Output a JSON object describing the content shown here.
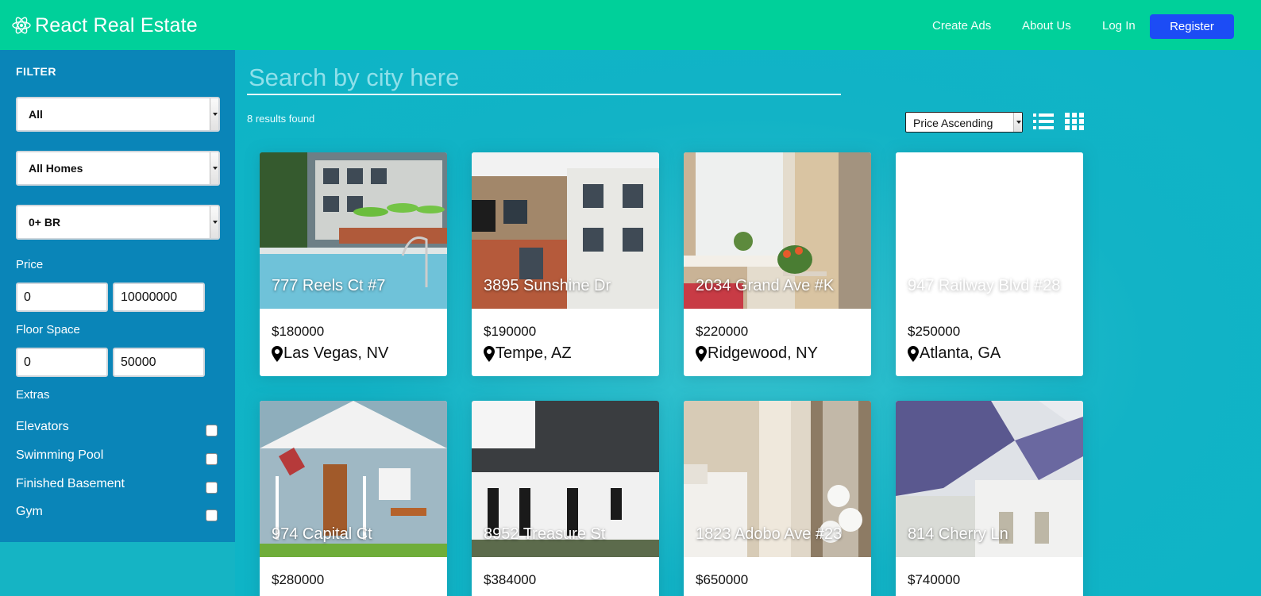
{
  "header": {
    "brand": "React Real Estate",
    "nav": {
      "create_ads": "Create Ads",
      "about_us": "About Us",
      "log_in": "Log In",
      "register": "Register"
    }
  },
  "colors": {
    "header_bg": "#00d09a",
    "sidebar_bg": "#0a85b8",
    "main_bg": "#15b4c4",
    "register_btn": "#1c4cf5"
  },
  "sidebar": {
    "title": "FILTER",
    "type_select": "All",
    "home_select": "All Homes",
    "bedroom_select": "0+ BR",
    "price_label": "Price",
    "price_min": "0",
    "price_max": "10000000",
    "floor_label": "Floor Space",
    "floor_min": "0",
    "floor_max": "50000",
    "extras_label": "Extras",
    "extras": [
      {
        "label": "Elevators",
        "checked": false
      },
      {
        "label": "Swimming Pool",
        "checked": false
      },
      {
        "label": "Finished Basement",
        "checked": false
      },
      {
        "label": "Gym",
        "checked": false
      }
    ]
  },
  "main": {
    "search_placeholder": "Search by city here",
    "results_text": "8 results found",
    "sort_value": "Price Ascending",
    "listings": [
      {
        "address": "777 Reels Ct #7",
        "price": "$180000",
        "location": "Las Vegas, NV"
      },
      {
        "address": "3895 Sunshine Dr",
        "price": "$190000",
        "location": "Tempe, AZ"
      },
      {
        "address": "2034 Grand Ave #K",
        "price": "$220000",
        "location": "Ridgewood, NY"
      },
      {
        "address": "947 Railway Blvd #28",
        "price": "$250000",
        "location": "Atlanta, GA"
      },
      {
        "address": "974 Capital Ct",
        "price": "$280000",
        "location": ""
      },
      {
        "address": "8952 Treasure St",
        "price": "$384000",
        "location": ""
      },
      {
        "address": "1823 Adobo Ave #23",
        "price": "$650000",
        "location": ""
      },
      {
        "address": "814 Cherry Ln",
        "price": "$740000",
        "location": ""
      }
    ]
  }
}
